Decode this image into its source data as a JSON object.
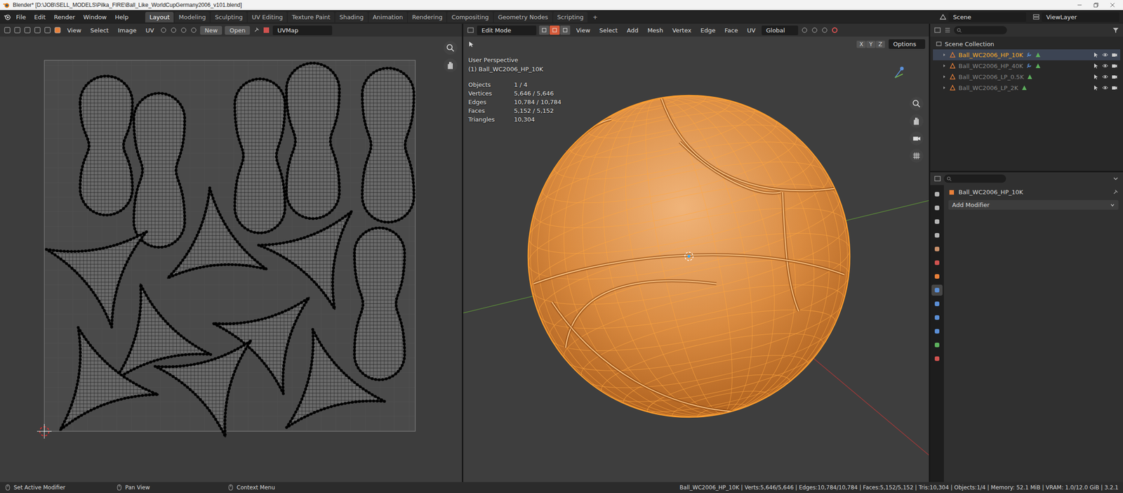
{
  "window": {
    "title": "Blender* [D:\\JOB\\SELL_MODELS\\Pilka_FIRE\\Ball_Like_WorldCupGermany2006_v101.blend]"
  },
  "menu": [
    "File",
    "Edit",
    "Render",
    "Window",
    "Help"
  ],
  "workspaces": [
    {
      "label": "Layout",
      "selected": true
    },
    {
      "label": "Modeling",
      "selected": false
    },
    {
      "label": "Sculpting",
      "selected": false
    },
    {
      "label": "UV Editing",
      "selected": false
    },
    {
      "label": "Texture Paint",
      "selected": false
    },
    {
      "label": "Shading",
      "selected": false
    },
    {
      "label": "Animation",
      "selected": false
    },
    {
      "label": "Rendering",
      "selected": false
    },
    {
      "label": "Compositing",
      "selected": false
    },
    {
      "label": "Geometry Nodes",
      "selected": false
    },
    {
      "label": "Scripting",
      "selected": false
    }
  ],
  "add_workspace": "+",
  "scene": "Scene",
  "view_layer": "ViewLayer",
  "uv_editor": {
    "menus": [
      "View",
      "Select",
      "Image",
      "UV"
    ],
    "new_button": "New",
    "open_button": "Open",
    "uv_map": "UVMap"
  },
  "viewport": {
    "mode": "Edit Mode",
    "select_modes": [
      {
        "selected": false
      },
      {
        "selected": true
      },
      {
        "selected": false
      }
    ],
    "menus": [
      "View",
      "Select",
      "Add",
      "Mesh",
      "Vertex",
      "Edge",
      "Face",
      "UV"
    ],
    "orientation": "Global",
    "mirror_axes": [
      {
        "label": "X",
        "on": false
      },
      {
        "label": "Y",
        "on": false
      },
      {
        "label": "Z",
        "on": false
      }
    ],
    "options": "Options",
    "view_name": "User Perspective",
    "object_label": "(1) Ball_WC2006_HP_10K",
    "stats": [
      {
        "label": "Objects",
        "value": "1 / 4"
      },
      {
        "label": "Vertices",
        "value": "5,646 / 5,646"
      },
      {
        "label": "Edges",
        "value": "10,784 / 10,784"
      },
      {
        "label": "Faces",
        "value": "5,152 / 5,152"
      },
      {
        "label": "Triangles",
        "value": "10,304"
      }
    ]
  },
  "outliner": {
    "root": "Scene Collection",
    "items": [
      {
        "name": "Ball_WC2006_HP_10K",
        "selected": true,
        "dimmed": false,
        "has_modifiers": true
      },
      {
        "name": "Ball_WC2006_HP_40K",
        "selected": false,
        "dimmed": true,
        "has_modifiers": true
      },
      {
        "name": "Ball_WC2006_LP_0.5K",
        "selected": false,
        "dimmed": true,
        "has_modifiers": false
      },
      {
        "name": "Ball_WC2006_LP_2K",
        "selected": false,
        "dimmed": true,
        "has_modifiers": false
      }
    ]
  },
  "properties": {
    "object_name": "Ball_WC2006_HP_10K",
    "add_modifier": "Add Modifier",
    "tabs": [
      {
        "selected": false,
        "color": "#b5b5b5"
      },
      {
        "selected": false,
        "color": "#b5b5b5"
      },
      {
        "selected": false,
        "color": "#b5b5b5"
      },
      {
        "selected": false,
        "color": "#b5b5b5"
      },
      {
        "selected": false,
        "color": "#c9906a"
      },
      {
        "selected": false,
        "color": "#d0524f"
      },
      {
        "selected": false,
        "color": "#e8803a"
      },
      {
        "selected": true,
        "color": "#5b8fd6"
      },
      {
        "selected": false,
        "color": "#5b8fd6"
      },
      {
        "selected": false,
        "color": "#5b8fd6"
      },
      {
        "selected": false,
        "color": "#5b8fd6"
      },
      {
        "selected": false,
        "color": "#5db05d"
      },
      {
        "selected": false,
        "color": "#d0524f"
      }
    ]
  },
  "status_bar": {
    "hints": [
      "Set Active Modifier",
      "Pan View",
      "Context Menu"
    ],
    "stats": "Ball_WC2006_HP_10K | Verts:5,646/5,646 | Edges:10,784/10,784 | Faces:5,152/5,152 | Tris:10,304 | Objects:1/4 | Memory: 52.1 MiB | VRAM: 1.0/12.0 GiB | 3.2.1"
  }
}
